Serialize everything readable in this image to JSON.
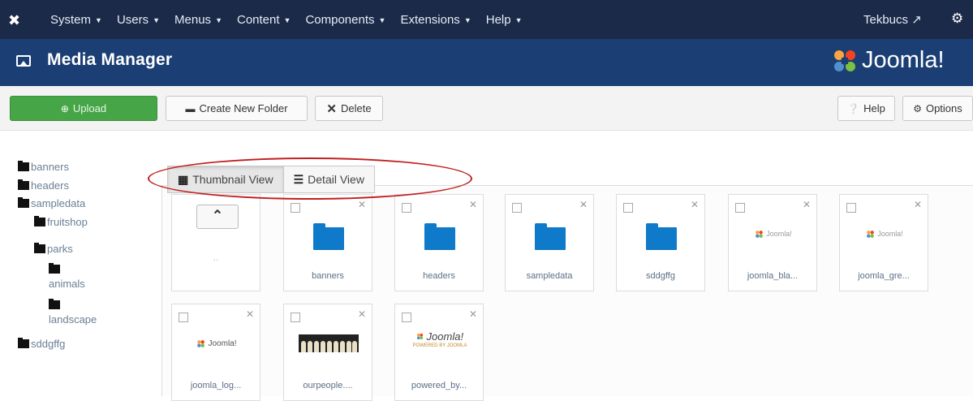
{
  "navbar": {
    "menu": [
      "System",
      "Users",
      "Menus",
      "Content",
      "Components",
      "Extensions",
      "Help"
    ],
    "user": "Tekbucs",
    "user_icon": "external-link-icon",
    "settings_icon": "gear-icon"
  },
  "titlebar": {
    "title": "Media Manager",
    "brand": "Joomla!"
  },
  "toolbar": {
    "upload": "Upload",
    "create_folder": "Create New Folder",
    "delete": "Delete",
    "help": "Help",
    "options": "Options"
  },
  "tree": {
    "banners": "banners",
    "headers": "headers",
    "sampledata": "sampledata",
    "fruitshop": "fruitshop",
    "parks": "parks",
    "animals": "animals",
    "landscape": "landscape",
    "sddgffg": "sddgffg"
  },
  "views": {
    "thumbnail": "Thumbnail View",
    "detail": "Detail View",
    "active": "thumbnail"
  },
  "items": {
    "up_dots": "..",
    "banners": "banners",
    "headers": "headers",
    "sampledata": "sampledata",
    "sddgffg": "sddgffg",
    "joomla_bla": "joomla_bla...",
    "joomla_gre": "joomla_gre...",
    "joomla_log": "joomla_log...",
    "ourpeople": "ourpeople....",
    "powered_by": "powered_by..."
  },
  "thumb_text": {
    "joomla_small": "Joomla!",
    "powered_main": "Joomla!",
    "powered_sub": "POWERED BY JOOMLA"
  },
  "colors": {
    "navbar": "#1b2a48",
    "titlebar": "#1b3f74",
    "upload": "#46a546",
    "folder": "#0f7ac9",
    "highlight_ellipse": "#c21f1f"
  }
}
